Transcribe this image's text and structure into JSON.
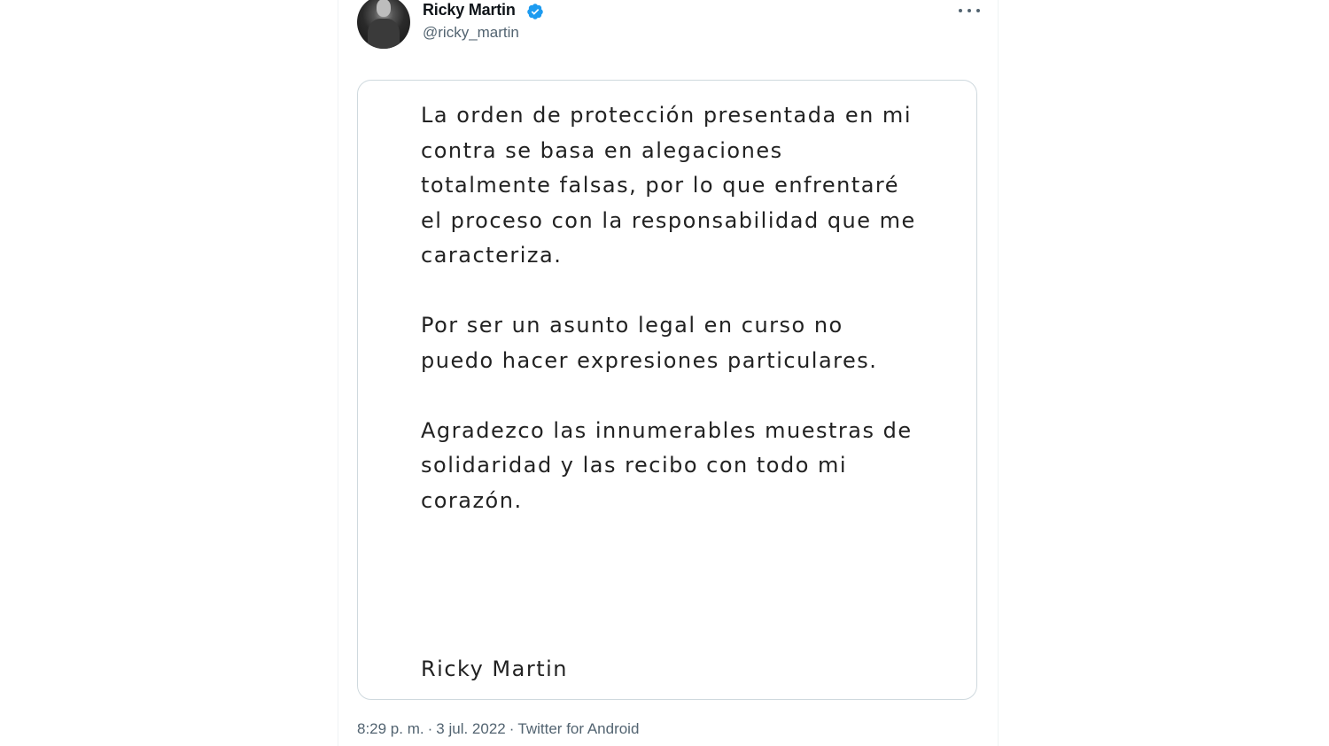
{
  "tweet": {
    "author": {
      "display_name": "Ricky Martin",
      "handle": "@ricky_martin",
      "verified": true
    },
    "more_icon": "more-horizontal-icon",
    "verified_icon": "verified-badge-icon",
    "verified_color": "#1d9bf0",
    "media": {
      "paragraphs": [
        "La orden de protección presentada en mi contra se basa en alegaciones totalmente falsas, por lo que enfrentaré el proceso con la responsabilidad que me caracteriza.",
        "Por ser un asunto legal en curso no puedo hacer expresiones particulares.",
        "Agradezco las innumerables muestras de solidaridad y las recibo con todo mi corazón."
      ],
      "signature": "Ricky Martin"
    },
    "meta": {
      "time": "8:29 p. m.",
      "separator": "·",
      "date": "3 jul. 2022",
      "source": "Twitter for Android"
    }
  }
}
